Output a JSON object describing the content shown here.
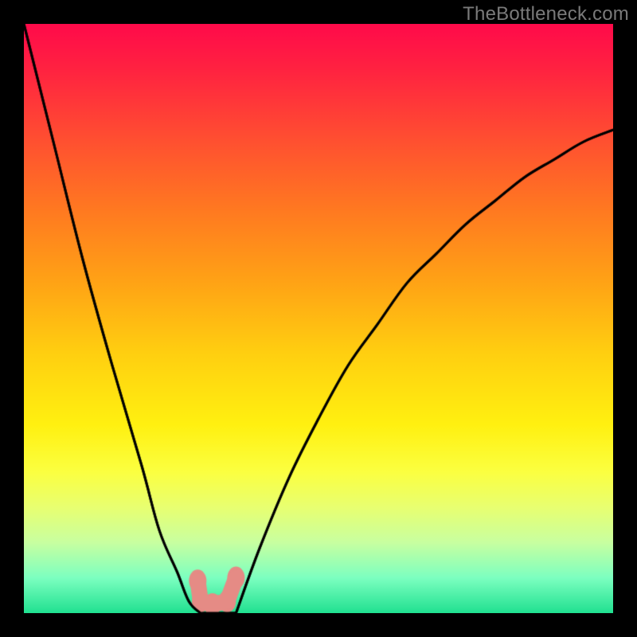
{
  "watermark": "TheBottleneck.com",
  "chart_data": {
    "type": "line",
    "title": "",
    "xlabel": "",
    "ylabel": "",
    "xlim": [
      0,
      1
    ],
    "ylim": [
      0,
      1
    ],
    "series": [
      {
        "name": "left-branch",
        "x": [
          0.0,
          0.05,
          0.1,
          0.15,
          0.2,
          0.23,
          0.26,
          0.28,
          0.3
        ],
        "values": [
          1.0,
          0.8,
          0.6,
          0.42,
          0.25,
          0.14,
          0.07,
          0.02,
          0.0
        ]
      },
      {
        "name": "basin",
        "x": [
          0.3,
          0.31,
          0.33,
          0.35,
          0.36
        ],
        "values": [
          0.0,
          0.0,
          0.0,
          0.0,
          0.0
        ]
      },
      {
        "name": "right-branch",
        "x": [
          0.36,
          0.4,
          0.45,
          0.5,
          0.55,
          0.6,
          0.65,
          0.7,
          0.75,
          0.8,
          0.85,
          0.9,
          0.95,
          1.0
        ],
        "values": [
          0.0,
          0.11,
          0.23,
          0.33,
          0.42,
          0.49,
          0.56,
          0.61,
          0.66,
          0.7,
          0.74,
          0.77,
          0.8,
          0.82
        ]
      }
    ],
    "markers": [
      {
        "x": 0.295,
        "y": 0.055
      },
      {
        "x": 0.3,
        "y": 0.02
      },
      {
        "x": 0.32,
        "y": 0.015
      },
      {
        "x": 0.345,
        "y": 0.02
      },
      {
        "x": 0.36,
        "y": 0.06
      }
    ],
    "gradient_stops": [
      {
        "pos": 0.0,
        "color": "#ff0a4a"
      },
      {
        "pos": 0.2,
        "color": "#ff5030"
      },
      {
        "pos": 0.44,
        "color": "#ffa315"
      },
      {
        "pos": 0.68,
        "color": "#fff010"
      },
      {
        "pos": 0.88,
        "color": "#c8ffa0"
      },
      {
        "pos": 1.0,
        "color": "#20e090"
      }
    ]
  }
}
